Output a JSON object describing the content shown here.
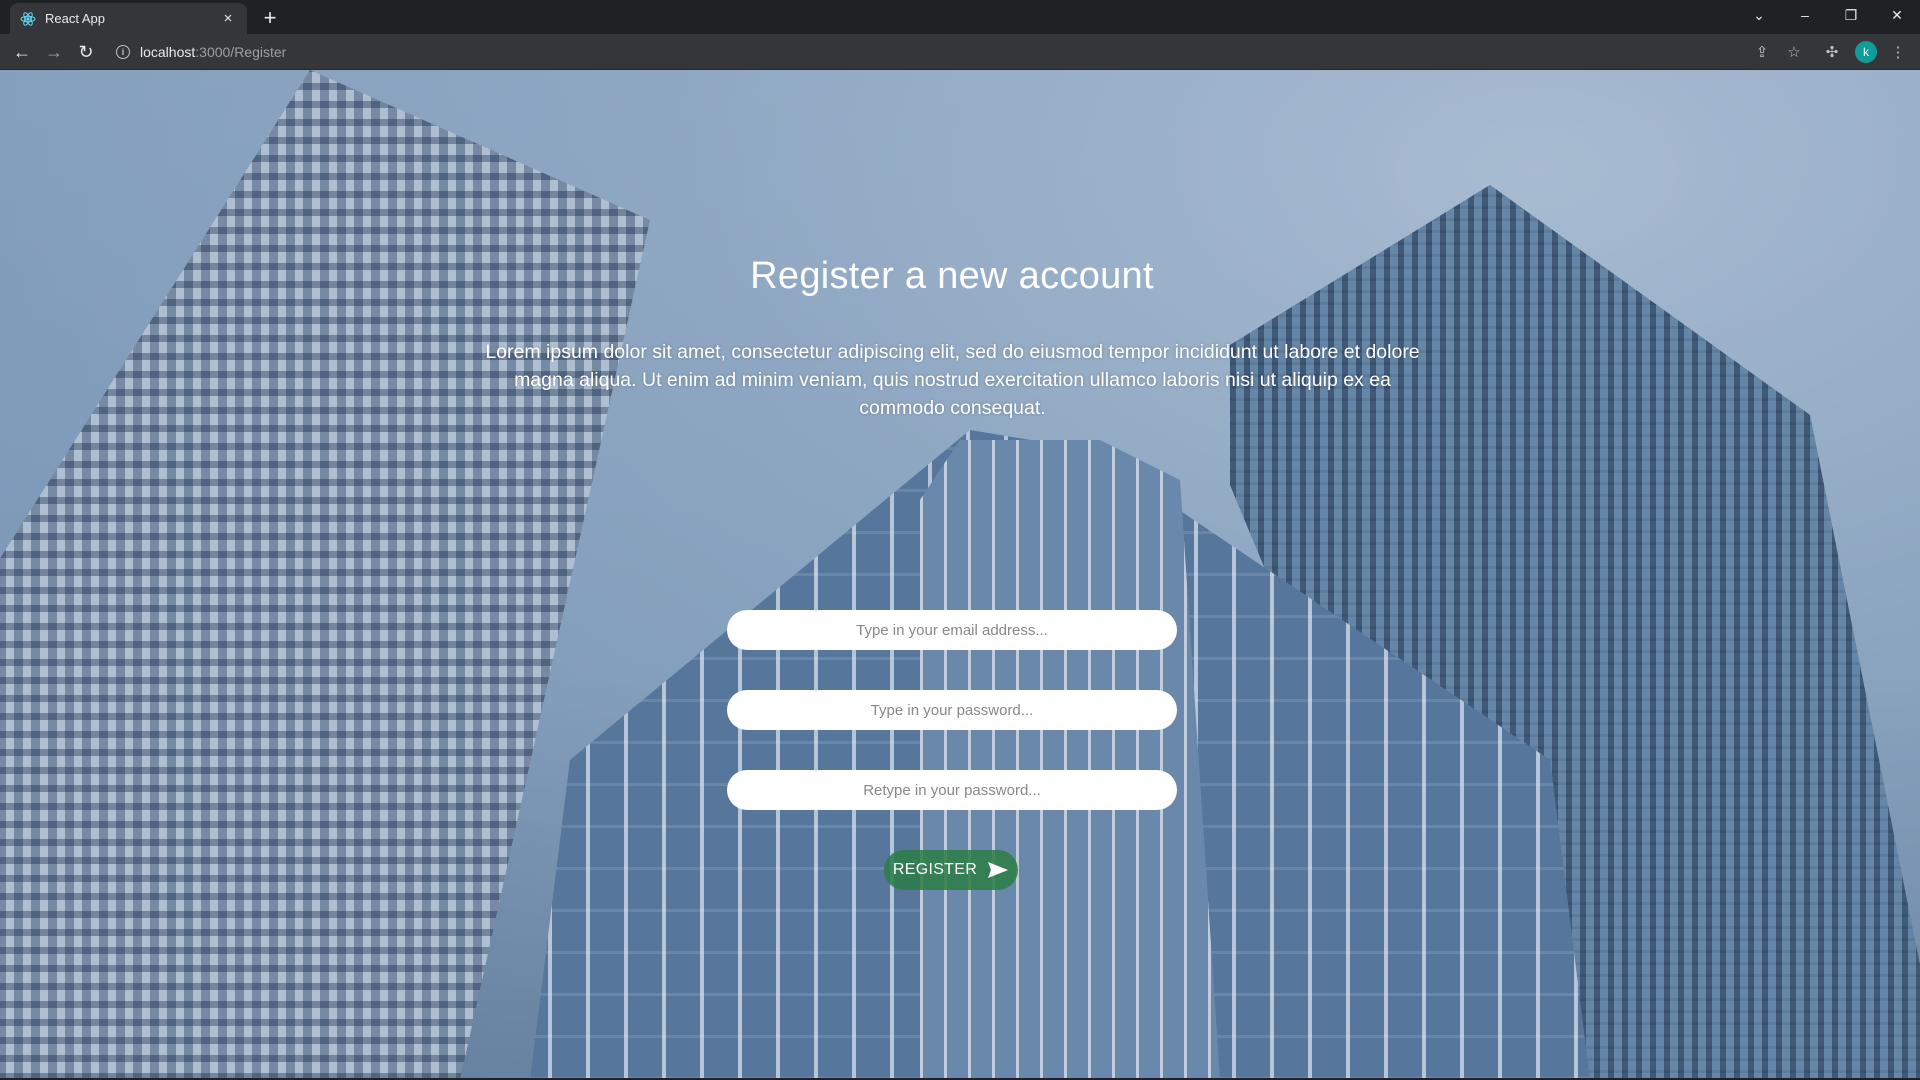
{
  "browser": {
    "tab_title": "React App",
    "tab_close": "×",
    "new_tab": "+",
    "url_host": "localhost",
    "url_path": ":3000/Register",
    "profile_initial": "k",
    "window_controls": {
      "dropdown": "⌄",
      "minimize": "–",
      "restore": "❐",
      "close": "✕"
    },
    "nav": {
      "back": "←",
      "forward": "→",
      "reload": "↻"
    },
    "toolbar_icons": {
      "share": "⇪",
      "bookmark": "☆",
      "extensions": "✣",
      "menu": "⋮"
    }
  },
  "register": {
    "heading": "Register a new account",
    "intro": "Lorem ipsum dolor sit amet, consectetur adipiscing elit, sed do eiusmod tempor incididunt ut labore et dolore magna aliqua. Ut enim ad minim veniam, quis nostrud exercitation ullamco laboris nisi ut aliquip ex ea commodo consequat.",
    "email_placeholder": "Type in your email address...",
    "password_placeholder": "Type in your password...",
    "retype_placeholder": "Retype in your password...",
    "button_label": "REGISTER"
  },
  "colors": {
    "button_green": "#2e7d49",
    "chrome_dark": "#202124",
    "chrome_toolbar": "#35363a",
    "avatar": "#0f9d9a"
  },
  "icons": {
    "favicon": "react-logo-icon",
    "send": "send-arrow-icon",
    "site_info": "info-icon"
  }
}
